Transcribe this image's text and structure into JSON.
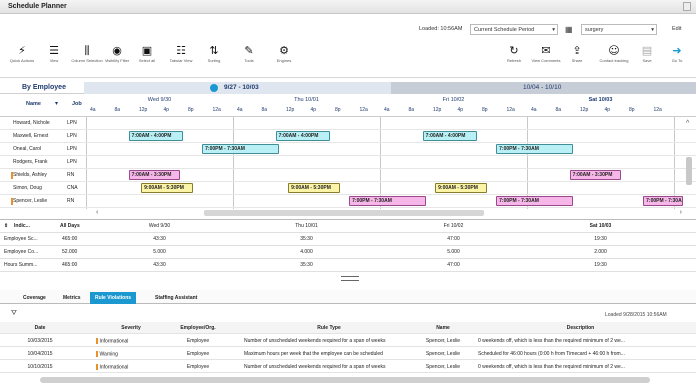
{
  "app": {
    "title": "Schedule Planner"
  },
  "topbar": {
    "loaded": "Loaded: 10:56AM",
    "period": "Current Schedule Period",
    "unit": "surgery",
    "edit": "Edit"
  },
  "toolbar": {
    "left": [
      {
        "icon": "bolt-icon",
        "glyph": "⚡",
        "label": "Quick Actions"
      },
      {
        "icon": "view-icon",
        "glyph": "☰",
        "label": "View"
      },
      {
        "icon": "column-selection-icon",
        "glyph": "⫼",
        "label": "Column Selection"
      },
      {
        "icon": "eye-icon",
        "glyph": "◉",
        "label": "Visibility Filter"
      },
      {
        "icon": "select-all-icon",
        "glyph": "▣",
        "label": "Select all"
      },
      {
        "icon": "tabular-view-icon",
        "glyph": "☷",
        "label": "Tabular View"
      },
      {
        "icon": "sort-icon",
        "glyph": "⇅",
        "label": "Sorting"
      },
      {
        "icon": "wrench-icon",
        "glyph": "✎",
        "label": "Tools"
      },
      {
        "icon": "engine-icon",
        "glyph": "⚙",
        "label": "Engines"
      }
    ],
    "right": [
      {
        "icon": "refresh-icon",
        "glyph": "↻",
        "label": "Refresh"
      },
      {
        "icon": "comments-icon",
        "glyph": "✉",
        "label": "View Comments"
      },
      {
        "icon": "share-icon",
        "glyph": "⇪",
        "label": "Share"
      },
      {
        "icon": "contact-tracking-icon",
        "glyph": "☺",
        "label": "Contact tracking"
      },
      {
        "icon": "save-icon",
        "glyph": "▤",
        "label": "Save"
      },
      {
        "icon": "goto-icon",
        "glyph": "➜",
        "label": "Go To"
      }
    ]
  },
  "grid": {
    "by_label": "By Employee",
    "range_current": "9/27 - 10/03",
    "range_next": "10/04 - 10/10",
    "col_name": "Name",
    "col_job": "Job",
    "days": [
      "Wed 9/30",
      "Thu 10/01",
      "Fri 10/02",
      "Sat 10/03"
    ],
    "hours": [
      "4a",
      "8a",
      "12p",
      "4p",
      "8p",
      "12a"
    ],
    "rows": [
      {
        "name": "Howard, Nichole",
        "job": "LPN",
        "flag": false,
        "shifts": []
      },
      {
        "name": "Maxwell, Ernest",
        "job": "LPN",
        "flag": false,
        "shifts": [
          {
            "text": "7:00AM - 4:00PM",
            "color": "cyan",
            "start": 0.29,
            "len": 0.37,
            "day": 0
          },
          {
            "text": "7:00AM - 4:00PM",
            "color": "cyan",
            "start": 0.29,
            "len": 0.37,
            "day": 1
          },
          {
            "text": "7:00AM - 4:00PM",
            "color": "cyan",
            "start": 0.29,
            "len": 0.37,
            "day": 2
          }
        ]
      },
      {
        "name": "Oneal, Carol",
        "job": "LPN",
        "flag": false,
        "shifts": [
          {
            "text": "7:00PM - 7:30AM",
            "color": "cyan",
            "start": 0.79,
            "len": 0.52,
            "day": 0
          },
          {
            "text": "7:00PM - 7:30AM",
            "color": "cyan",
            "start": 0.79,
            "len": 0.52,
            "day": 2
          }
        ]
      },
      {
        "name": "Rodgers, Frank",
        "job": "LPN",
        "flag": false,
        "shifts": []
      },
      {
        "name": "Shields, Ashley",
        "job": "RN",
        "flag": true,
        "shifts": [
          {
            "text": "7:00AM - 3:30PM",
            "color": "pink",
            "start": 0.29,
            "len": 0.35,
            "day": 0
          },
          {
            "text": "7:00AM - 3:30PM",
            "color": "pink",
            "start": 0.29,
            "len": 0.35,
            "day": 3
          }
        ]
      },
      {
        "name": "Simon, Doug",
        "job": "CNA",
        "flag": false,
        "shifts": [
          {
            "text": "9:00AM - 5:30PM",
            "color": "yellow",
            "start": 0.375,
            "len": 0.355,
            "day": 0
          },
          {
            "text": "9:00AM - 5:30PM",
            "color": "yellow",
            "start": 0.375,
            "len": 0.355,
            "day": 1
          },
          {
            "text": "9:00AM - 5:30PM",
            "color": "yellow",
            "start": 0.375,
            "len": 0.355,
            "day": 2
          }
        ]
      },
      {
        "name": "Spencer, Leslie",
        "job": "RN",
        "flag": true,
        "shifts": [
          {
            "text": "7:00PM - 7:30AM",
            "color": "pink",
            "start": 0.79,
            "len": 0.52,
            "day": 1
          },
          {
            "text": "7:00PM - 7:30AM",
            "color": "pink",
            "start": 0.79,
            "len": 0.52,
            "day": 2
          },
          {
            "text": "7:00PM - 7:30AM",
            "color": "pink",
            "start": 0.79,
            "len": 0.3,
            "day": 3
          }
        ]
      }
    ]
  },
  "summary": {
    "indicator": "Indic...",
    "all_days": "All Days",
    "days": [
      "Wed 9/30",
      "Thu 10/01",
      "Fri 10/02",
      "Sat 10/03"
    ],
    "rows": [
      {
        "label": "Employee Sc...",
        "all": "465:00",
        "vals": [
          "43:30",
          "35:30",
          "47:00",
          "19:30"
        ]
      },
      {
        "label": "Employee Co...",
        "all": "52.000",
        "vals": [
          "5.000",
          "4.000",
          "5.000",
          "2.000"
        ]
      },
      {
        "label": "Hours Summ...",
        "all": "465:00",
        "vals": [
          "43:30",
          "35:30",
          "47:00",
          "19:30"
        ]
      }
    ]
  },
  "bottom": {
    "tabs": [
      "Coverage",
      "Metrics",
      "Rule Violations",
      "Staffing Assistant"
    ],
    "active_tab": 2,
    "loaded": "Loaded  9/28/2015 10:56AM",
    "columns": [
      "Date",
      "Severity",
      "Employee/Org.",
      "Rule Type",
      "Name",
      "Description"
    ],
    "rows": [
      {
        "date": "10/03/2015",
        "severity": "Informational",
        "emp": "Employee",
        "rule": "Number of unscheduled weekends required for a span of weeks",
        "name": "Spencer, Leslie",
        "desc": "0 weekends off, which is less than the required minimum of 2 we..."
      },
      {
        "date": "10/04/2015",
        "severity": "Warning",
        "emp": "Employee",
        "rule": "Maximum hours per week that the employee can be scheduled",
        "name": "Spencer, Leslie",
        "desc": "Scheduled for 46:00 hours (0:00 h from Timecard + 46:00 h from..."
      },
      {
        "date": "10/10/2015",
        "severity": "Informational",
        "emp": "Employee",
        "rule": "Number of unscheduled weekends required for a span of weeks",
        "name": "Spencer, Leslie",
        "desc": "0 weekends off, which is less than the required minimum of 2 we..."
      }
    ]
  },
  "colors": {
    "navy": "#1f3a6e",
    "accent": "#1a98cf",
    "cyan": "#b8f0f5",
    "yellow": "#fbf3a6",
    "pink": "#f7b6e8"
  }
}
